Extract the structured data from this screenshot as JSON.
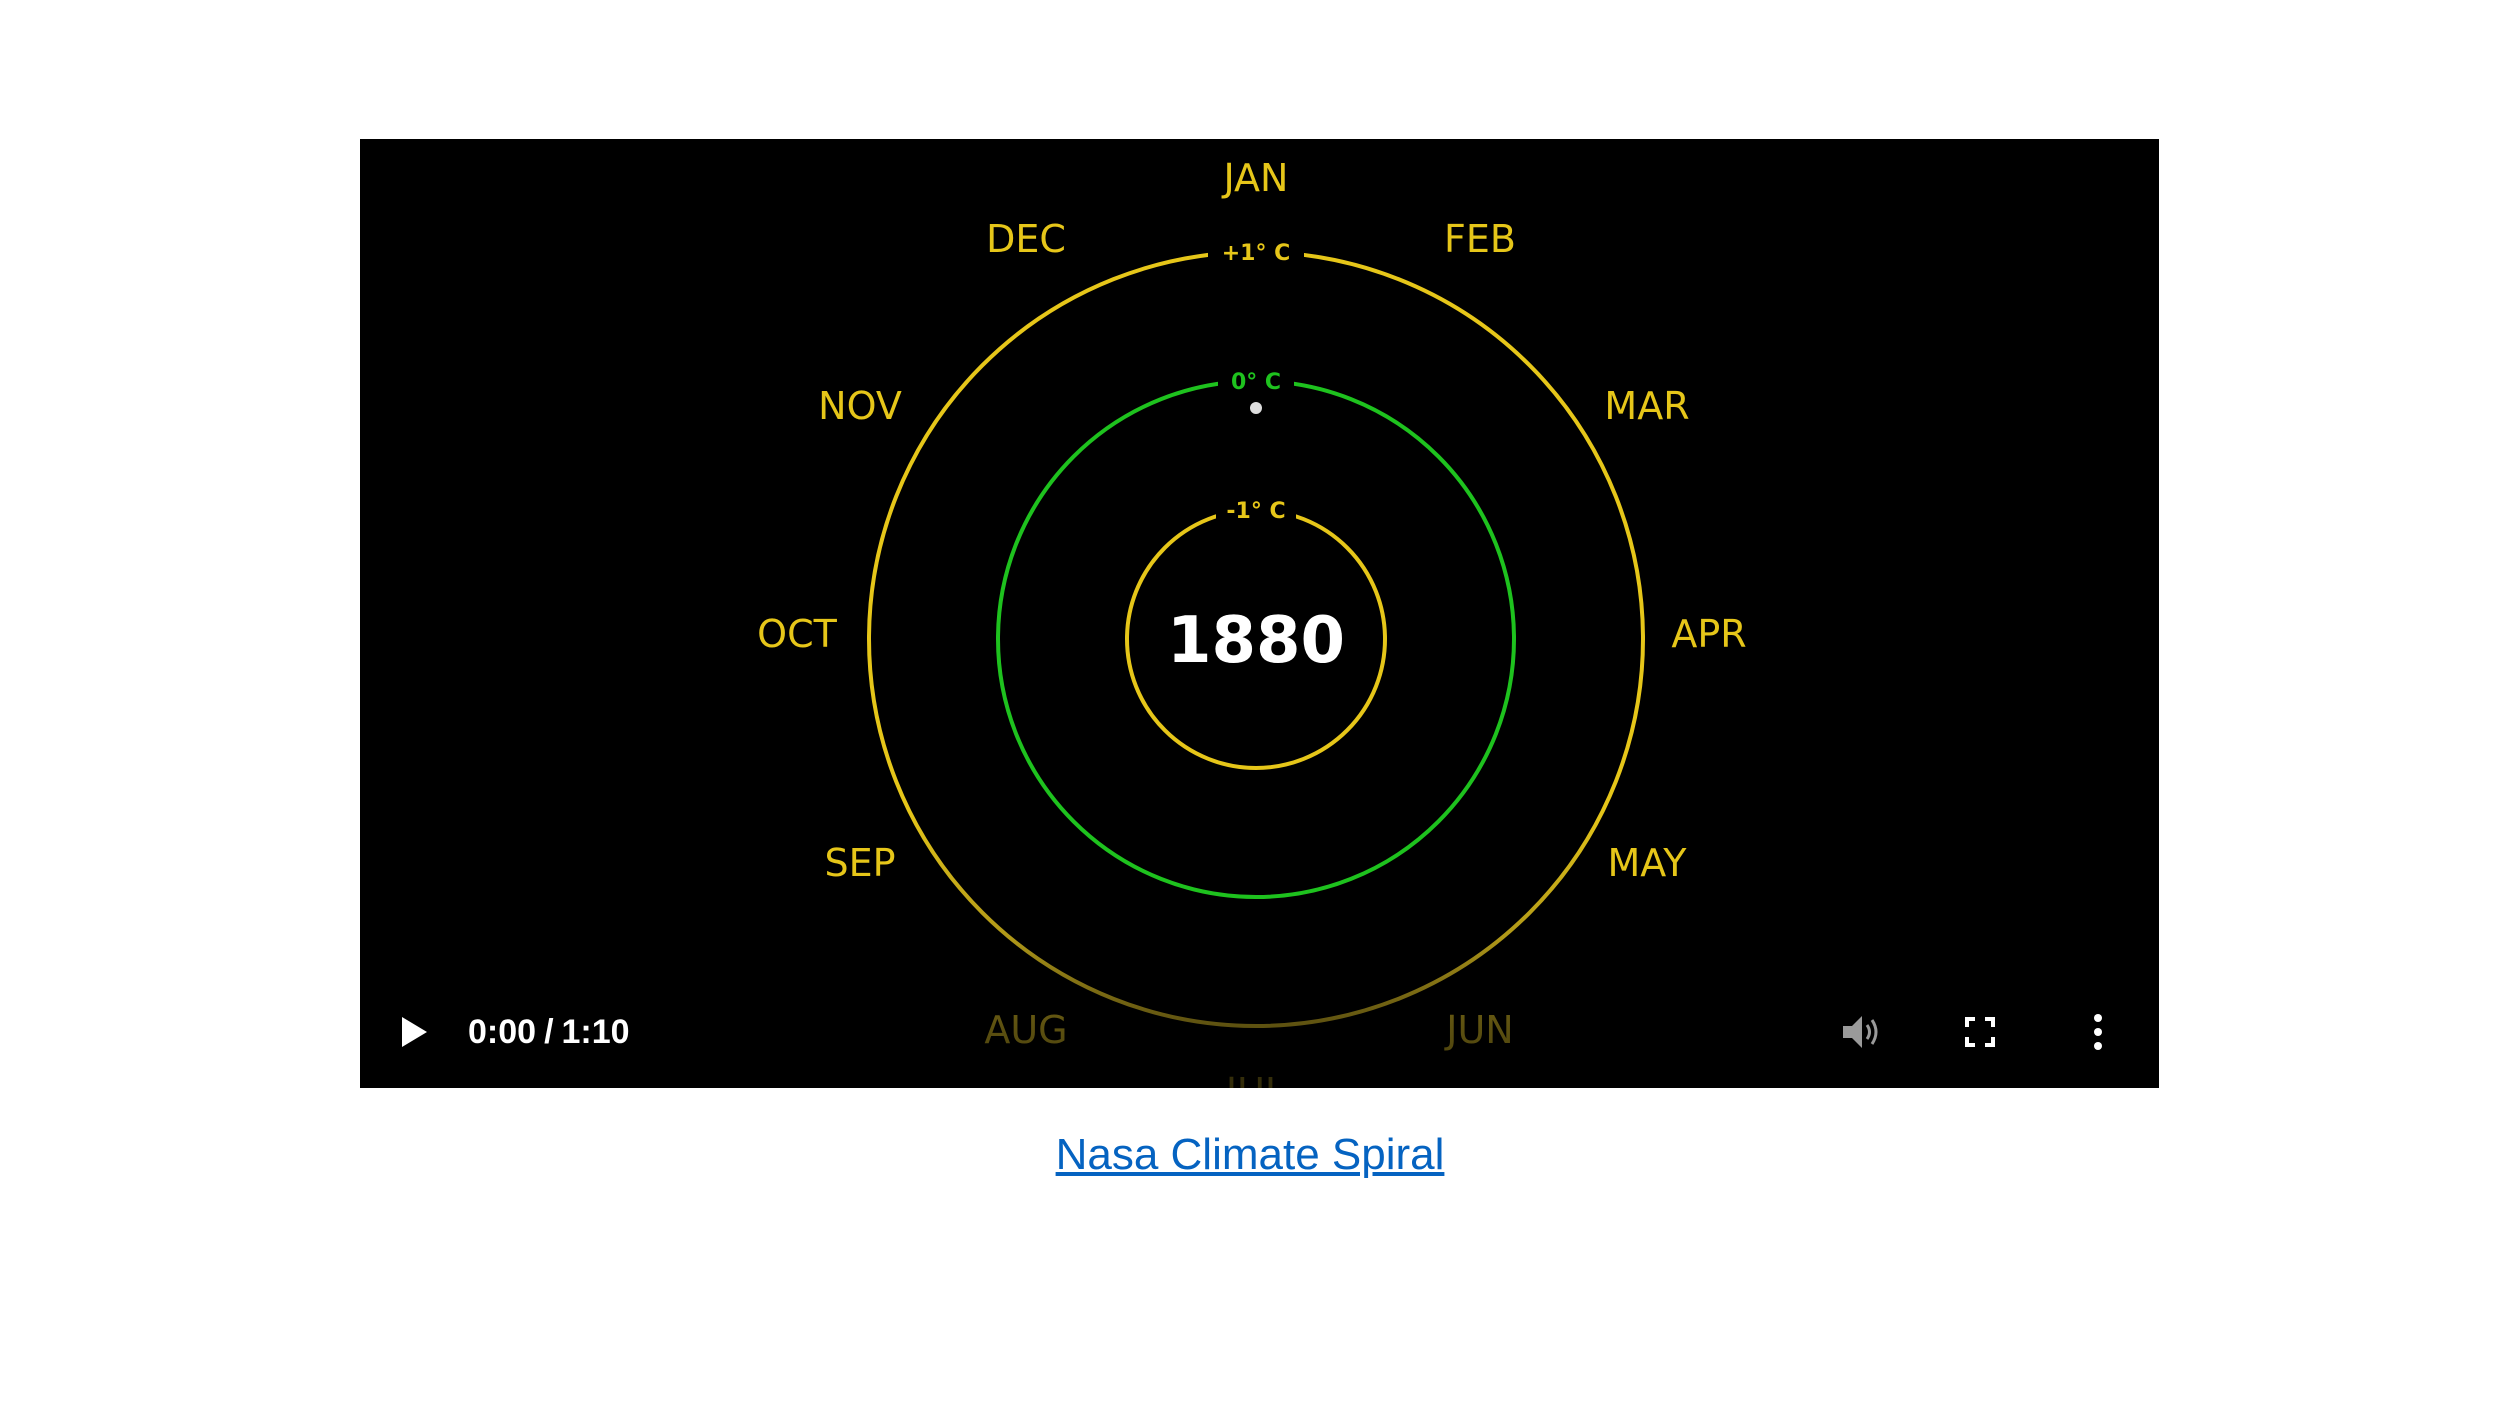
{
  "video": {
    "year": "1880",
    "months": [
      "JAN",
      "FEB",
      "MAR",
      "APR",
      "MAY",
      "JUN",
      "JUL",
      "AUG",
      "SEP",
      "OCT",
      "NOV",
      "DEC"
    ],
    "rings": {
      "outer": {
        "label": "+1° C",
        "color": "#e6c619"
      },
      "middle": {
        "label": "0° C",
        "color": "#1ec21e"
      },
      "inner": {
        "label": "-1° C",
        "color": "#e6c619"
      }
    },
    "month_color": "#e6c619",
    "year_color": "#ffffff",
    "marker_color": "#dddddd"
  },
  "controls": {
    "current_time": "0:00",
    "separator": "/",
    "duration": "1:10",
    "play_icon": "play-icon",
    "volume_icon": "volume-icon",
    "fullscreen_icon": "fullscreen-icon",
    "more_icon": "more-vertical-icon"
  },
  "caption": {
    "link_text": "Nasa Climate Spiral"
  }
}
